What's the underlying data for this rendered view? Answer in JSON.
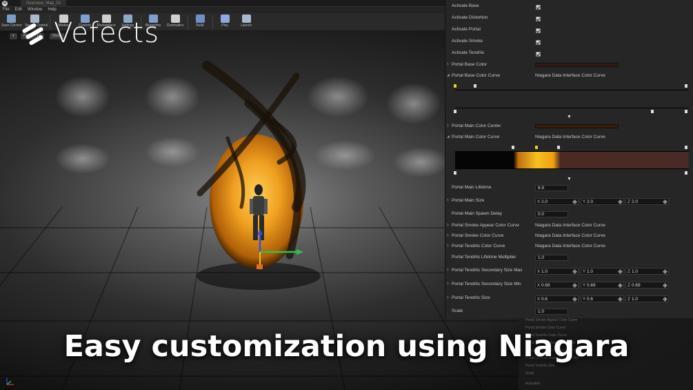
{
  "editor": {
    "tab_title": "Overview_Map_02",
    "menu": [
      "File",
      "Edit",
      "Window",
      "Help"
    ],
    "toolbar": [
      {
        "label": "Save Current",
        "icon": "save-icon"
      },
      {
        "label": "Source Control",
        "icon": "source-control-icon"
      },
      {
        "label": "Modes",
        "icon": "modes-icon"
      },
      {
        "label": "Content",
        "icon": "content-icon"
      },
      {
        "label": "Marketplace",
        "icon": "marketplace-icon"
      },
      {
        "label": "Settings",
        "icon": "settings-icon"
      },
      {
        "label": "Blueprints",
        "icon": "blueprints-icon"
      },
      {
        "label": "Cinematics",
        "icon": "cinematics-icon"
      },
      {
        "label": "Build",
        "icon": "build-icon"
      },
      {
        "label": "Play",
        "icon": "play-icon"
      },
      {
        "label": "Launch",
        "icon": "launch-icon"
      }
    ],
    "viewport_buttons": [
      "Perspective",
      "Lit",
      "Show"
    ]
  },
  "brand": {
    "name": "Vefects"
  },
  "caption": "Easy customization using Niagara",
  "details": {
    "checkboxes": [
      {
        "label": "Activate Base",
        "checked": true
      },
      {
        "label": "Activate Distortion",
        "checked": true
      },
      {
        "label": "Activate Portal",
        "checked": true
      },
      {
        "label": "Activate Smoke",
        "checked": true
      },
      {
        "label": "Activate Tendrils",
        "checked": true
      }
    ],
    "portal_base_color": {
      "label": "Portal Base Color",
      "color": "#2e1a12"
    },
    "portal_base_color_curve": {
      "label": "Portal Base Color Curve",
      "value": "Niagara Data Interface Color Curve"
    },
    "portal_main_color_center": {
      "label": "Portal Main Color Center",
      "color": "#3a1c0a"
    },
    "portal_main_color_curve": {
      "label": "Portal Main Color Curve",
      "value": "Niagara Data Interface Color Curve"
    },
    "portal_main_lifetime": {
      "label": "Portal Main Lifetime",
      "value": "6.9"
    },
    "portal_main_size": {
      "label": "Portal Main Size",
      "x": "2.0",
      "y": "2.0",
      "z": "2.0"
    },
    "portal_main_spawn_delay": {
      "label": "Portal Main Spawn Delay",
      "value": "0.0"
    },
    "portal_smoke_appear_color_curve": {
      "label": "Portal Smoke Appear Color Curve",
      "value": "Niagara Data Interface Color Curve"
    },
    "portal_smoke_color_curve": {
      "label": "Portal Smoke Color Curve",
      "value": "Niagara Data Interface Color Curve"
    },
    "portal_tendrils_color_curve": {
      "label": "Portal Tendrils Color Curve",
      "value": "Niagara Data Interface Color Curve"
    },
    "portal_tendrils_lifetime_multiplier": {
      "label": "Portal Tendrils Lifetime Multiplier",
      "value": "1.0"
    },
    "portal_tendrils_secondary_size_max": {
      "label": "Portal Tendrils Secondary Size Max",
      "x": "1.0",
      "y": "1.0",
      "z": "1.0"
    },
    "portal_tendrils_secondary_size_min": {
      "label": "Portal Tendrils Secondary Size Min",
      "x": "0.69",
      "y": "0.69",
      "z": "0.69"
    },
    "portal_tendrils_size": {
      "label": "Portal Tendrils Size",
      "x": "0.6",
      "y": "0.6",
      "z": "1.0"
    },
    "scale": {
      "label": "Scale",
      "value": "1.0"
    }
  },
  "background_panel": {
    "rows": [
      "Portal Smoke Appear Color Curve",
      "Portal Smoke Color Curve",
      "Portal Tendrils Color Curve",
      "Portal Tendrils Lifetime Multiplier",
      "Portal Tendrils Secondary Size Max",
      "Portal Tendrils Secondary Size Min",
      "Portal Tendrils Size",
      "Scale",
      "Activation"
    ]
  },
  "axis_labels": {
    "x": "X",
    "y": "Y",
    "z": "Z"
  },
  "colors": {
    "portal": "#f0a020",
    "panel": "#262626",
    "gizmo_x": "#e03030",
    "gizmo_y": "#30c050",
    "gizmo_z": "#3050e0"
  }
}
